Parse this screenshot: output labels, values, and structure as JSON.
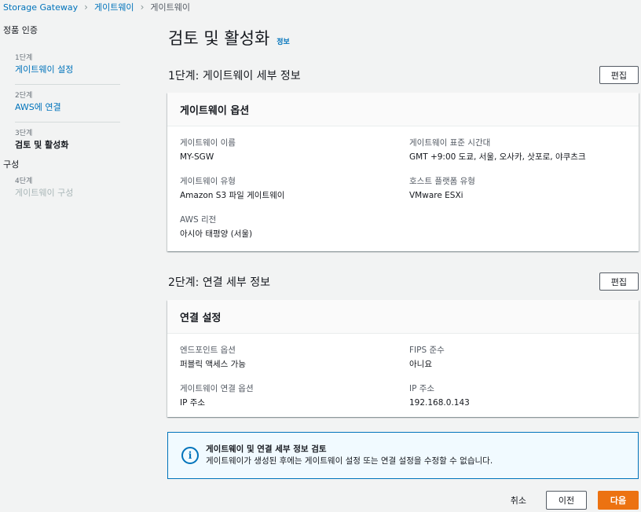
{
  "breadcrumb": {
    "items": [
      "Storage Gateway",
      "게이트웨이",
      "게이트웨이"
    ]
  },
  "nav": {
    "section1": "정품 인증",
    "section2": "구성",
    "steps": [
      {
        "num": "1단계",
        "label": "게이트웨이 설정"
      },
      {
        "num": "2단계",
        "label": "AWS에 연결"
      },
      {
        "num": "3단계",
        "label": "검토 및 활성화"
      },
      {
        "num": "4단계",
        "label": "게이트웨이 구성"
      }
    ]
  },
  "page": {
    "title": "검토 및 활성화",
    "info": "정보"
  },
  "step1": {
    "heading": "1단계: 게이트웨이 세부 정보",
    "edit": "편집",
    "card_title": "게이트웨이 옵션",
    "fields": [
      {
        "label": "게이트웨이 이름",
        "value": "MY-SGW"
      },
      {
        "label": "게이트웨이 표준 시간대",
        "value": "GMT +9:00 도쿄, 서울, 오사카, 삿포로, 야쿠츠크"
      },
      {
        "label": "게이트웨이 유형",
        "value": "Amazon S3 파일 게이트웨이"
      },
      {
        "label": "호스트 플랫폼 유형",
        "value": "VMware ESXi"
      },
      {
        "label": "AWS 리전",
        "value": "아시아 태평양 (서울)"
      }
    ]
  },
  "step2": {
    "heading": "2단계: 연결 세부 정보",
    "edit": "편집",
    "card_title": "연결 설정",
    "fields": [
      {
        "label": "엔드포인트 옵션",
        "value": "퍼블릭 액세스 가능"
      },
      {
        "label": "FIPS 준수",
        "value": "아니요"
      },
      {
        "label": "게이트웨이 연결 옵션",
        "value": "IP 주소"
      },
      {
        "label": "IP 주소",
        "value": "192.168.0.143"
      }
    ]
  },
  "alert": {
    "icon": "info-icon",
    "title": "게이트웨이 및 연결 세부 정보 검토",
    "message": "게이트웨이가 생성된 후에는 게이트웨이 설정 또는 연결 설정을 수정할 수 없습니다."
  },
  "footer": {
    "cancel": "취소",
    "previous": "이전",
    "next": "다음"
  },
  "colors": {
    "accent": "#0073bb",
    "primary_button": "#ec7211",
    "background": "#f2f3f3"
  }
}
